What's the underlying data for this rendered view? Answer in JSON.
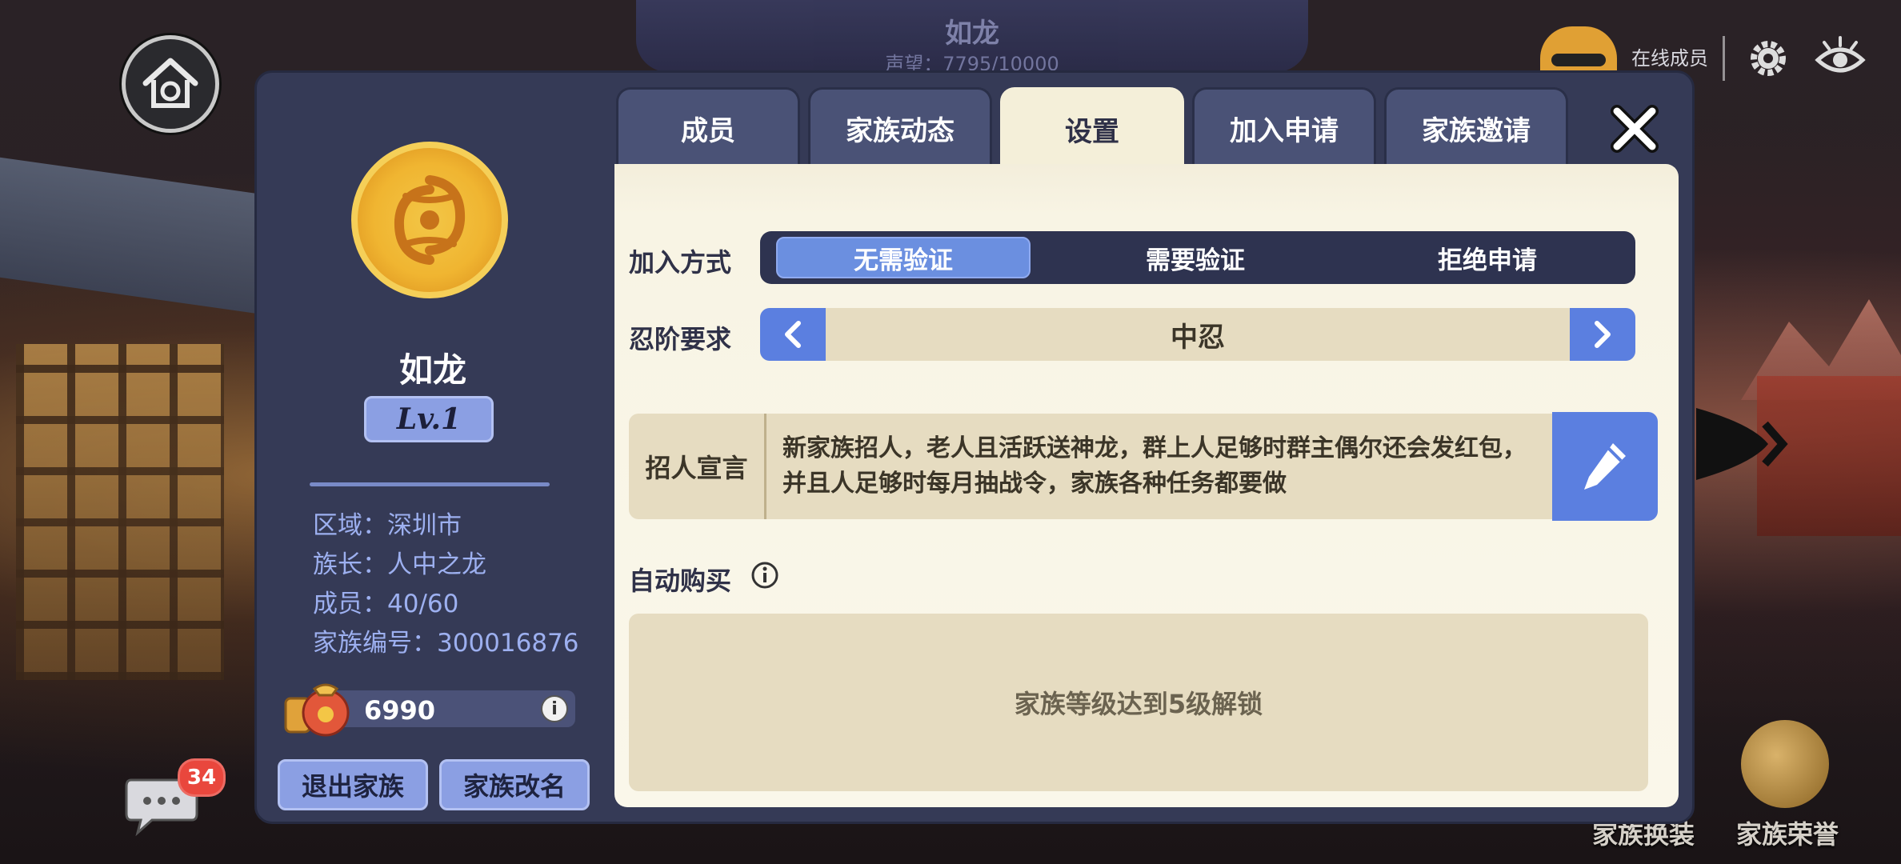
{
  "background": {
    "family_name": "如龙",
    "reputation": "声望：7795/10000",
    "online_label": "在线成员",
    "bottom_labels": [
      "家族换装",
      "家族荣誉"
    ],
    "chat_badge": "34"
  },
  "tabs": [
    {
      "label": "成员",
      "active": false
    },
    {
      "label": "家族动态",
      "active": false
    },
    {
      "label": "设置",
      "active": true
    },
    {
      "label": "加入申请",
      "active": false
    },
    {
      "label": "家族邀请",
      "active": false
    }
  ],
  "family": {
    "name": "如龙",
    "level": "Lv.1",
    "region": "区域：深圳市",
    "leader": "族长：人中之龙",
    "members": "成员：40/60",
    "id": "家族编号：300016876",
    "coins": "6990",
    "quit_button": "退出家族",
    "rename_button": "家族改名"
  },
  "settings": {
    "join_method_label": "加入方式",
    "join_options": [
      "无需验证",
      "需要验证",
      "拒绝申请"
    ],
    "join_selected": "无需验证",
    "rank_label": "忍阶要求",
    "rank_value": "中忍",
    "declaration_label": "招人宣言",
    "declaration_text": "新家族招人，老人且活跃送神龙，群上人足够时群主偶尔还会发红包，并且人足够时每月抽战令，家族各种任务都要做",
    "auto_buy_label": "自动购买",
    "auto_buy_locked_text": "家族等级达到5级解锁"
  },
  "colors": {
    "panel": "#353a56",
    "accent_blue": "#5b7fe0",
    "content_bg": "#faf7ea",
    "lock_bg": "#e6dcc1"
  }
}
